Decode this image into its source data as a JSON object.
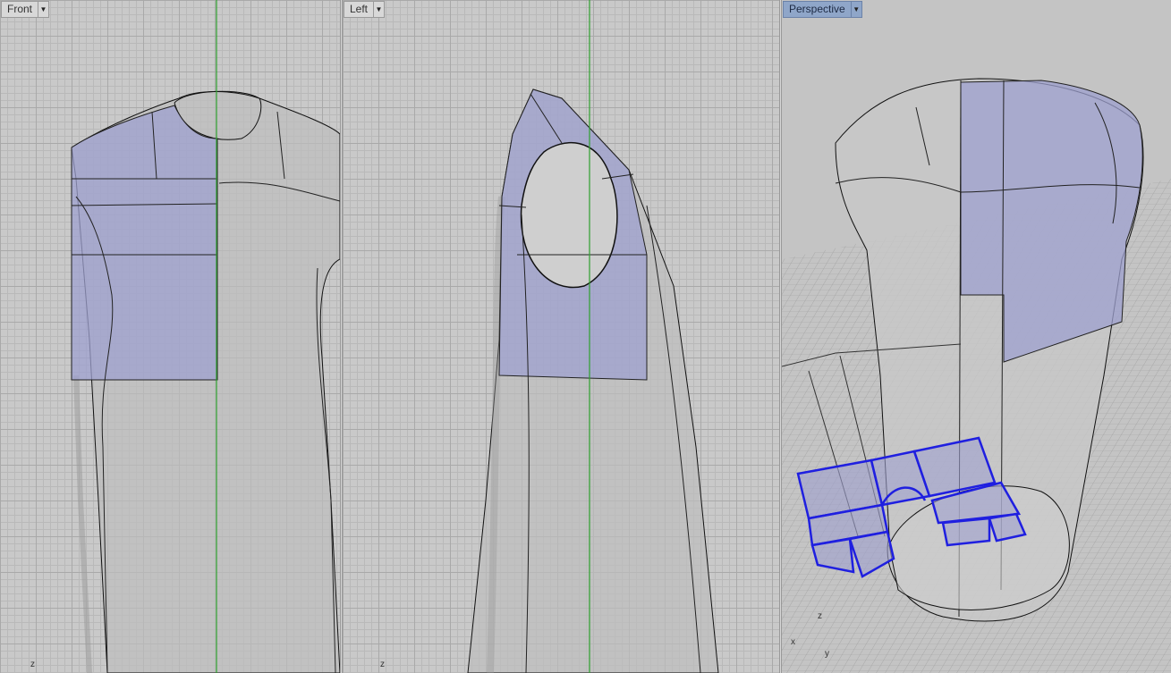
{
  "viewports": {
    "front": {
      "label": "Front",
      "axis": "z"
    },
    "left": {
      "label": "Left",
      "axis": "z"
    },
    "perspective": {
      "label": "Perspective",
      "axis_z": "z",
      "axis_x": "x",
      "axis_y": "y"
    }
  },
  "icons": {
    "dropdown": "chevron-down-icon",
    "cursor": "pointer-cursor-icon"
  },
  "colors": {
    "grid_bg": "#c9c9c9",
    "panel_fill": "#9ea0cf",
    "curve_selected": "#1f1fe0",
    "y_axis": "#2ea02e",
    "active_tab": "#8fa6c9"
  }
}
